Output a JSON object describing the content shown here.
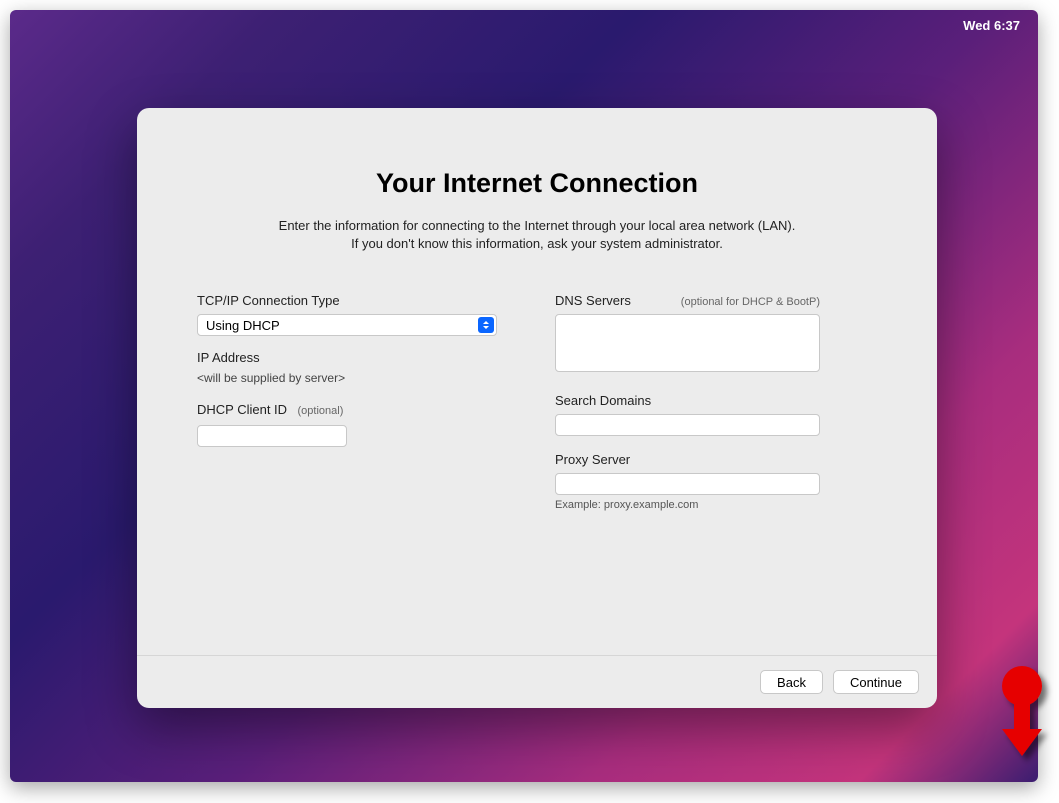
{
  "menubar": {
    "clock": "Wed 6:37"
  },
  "dialog": {
    "title": "Your Internet Connection",
    "subtitle_line1": "Enter the information for connecting to the Internet through your local area network (LAN).",
    "subtitle_line2": "If you don't know this information, ask your system administrator.",
    "left": {
      "tcpip_label": "TCP/IP Connection Type",
      "tcpip_value": "Using DHCP",
      "ip_label": "IP Address",
      "ip_value": "<will be supplied by server>",
      "dhcp_client_label": "DHCP Client ID",
      "dhcp_client_hint": "(optional)",
      "dhcp_client_value": ""
    },
    "right": {
      "dns_label": "DNS Servers",
      "dns_hint": "(optional for DHCP & BootP)",
      "dns_value": "",
      "search_label": "Search Domains",
      "search_value": "",
      "proxy_label": "Proxy Server",
      "proxy_value": "",
      "proxy_example": "Example: proxy.example.com"
    },
    "footer": {
      "back": "Back",
      "continue": "Continue"
    }
  }
}
